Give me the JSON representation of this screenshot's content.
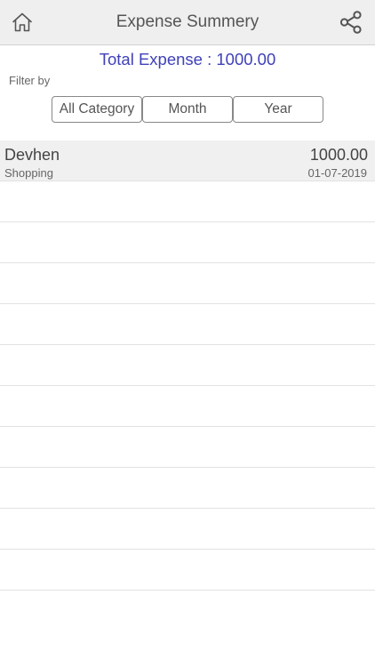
{
  "navbar": {
    "title": "Expense Summery",
    "left_icon": "home-icon",
    "right_icon": "share-icon"
  },
  "summary": {
    "total_text": "Total Expense : 1000.00",
    "filter_label": "Filter by"
  },
  "filters": [
    {
      "label": "All Category"
    },
    {
      "label": "Month"
    },
    {
      "label": "Year"
    }
  ],
  "expenses": [
    {
      "name": "Devhen",
      "category": "Shopping",
      "amount": "1000.00",
      "date": "01-07-2019"
    }
  ],
  "colors": {
    "accent": "#3f41b8",
    "navbar_bg": "#efefef",
    "row_highlight": "#f0f0f0"
  }
}
